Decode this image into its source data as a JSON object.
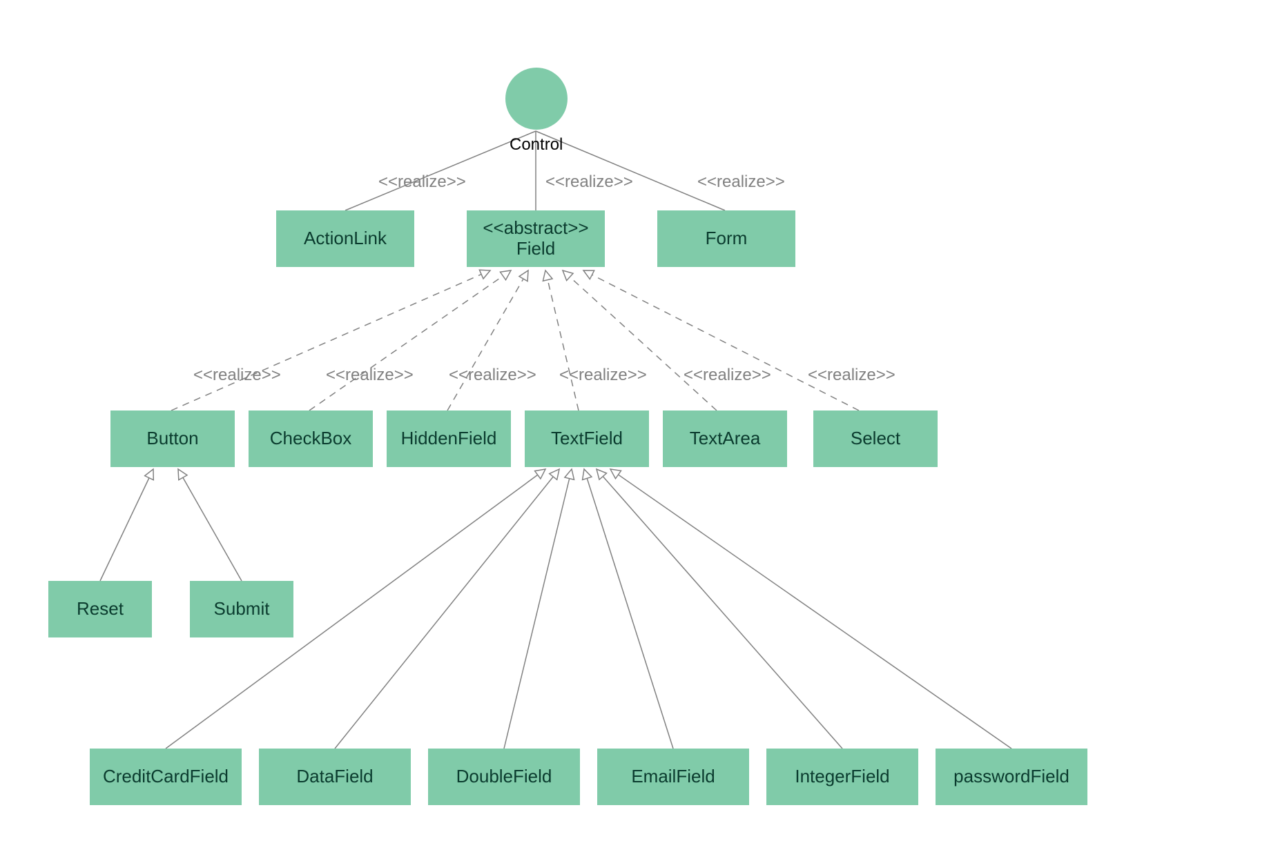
{
  "colors": {
    "nodeFill": "#80cba9",
    "edge": "#808080",
    "label": "#808080",
    "text": "#0a3b2e"
  },
  "root": {
    "label": "Control"
  },
  "stereotypes": {
    "realize": "<<realize>>",
    "abstract": "<<abstract>>"
  },
  "nodes": {
    "actionlink": "ActionLink",
    "field_stereo": "<<abstract>>",
    "field_name": "Field",
    "form": "Form",
    "button": "Button",
    "checkbox": "CheckBox",
    "hiddenfield": "HiddenField",
    "textfield": "TextField",
    "textarea": "TextArea",
    "select": "Select",
    "reset": "Reset",
    "submit": "Submit",
    "creditcard": "CreditCardField",
    "datafield": "DataField",
    "doublefield": "DoubleField",
    "emailfield": "EmailField",
    "integerfield": "IntegerField",
    "passwordfield": "passwordField"
  },
  "edgeLabels": {
    "r1": "<<realize>>",
    "r2": "<<realize>>",
    "r3": "<<realize>>",
    "r4": "<<realize>>",
    "r5": "<<realize>>",
    "r6": "<<realize>>",
    "r7": "<<realize>>",
    "r8": "<<realize>>",
    "r9": "<<realize>>"
  },
  "hierarchy": {
    "Control": {
      "realizes": [
        "ActionLink",
        "Field",
        "Form"
      ]
    },
    "Field": {
      "abstract": true,
      "realizes": [
        "Button",
        "CheckBox",
        "HiddenField",
        "TextField",
        "TextArea",
        "Select"
      ]
    },
    "Button": {
      "subclasses": [
        "Reset",
        "Submit"
      ]
    },
    "TextField": {
      "subclasses": [
        "CreditCardField",
        "DataField",
        "DoubleField",
        "EmailField",
        "IntegerField",
        "passwordField"
      ]
    }
  }
}
